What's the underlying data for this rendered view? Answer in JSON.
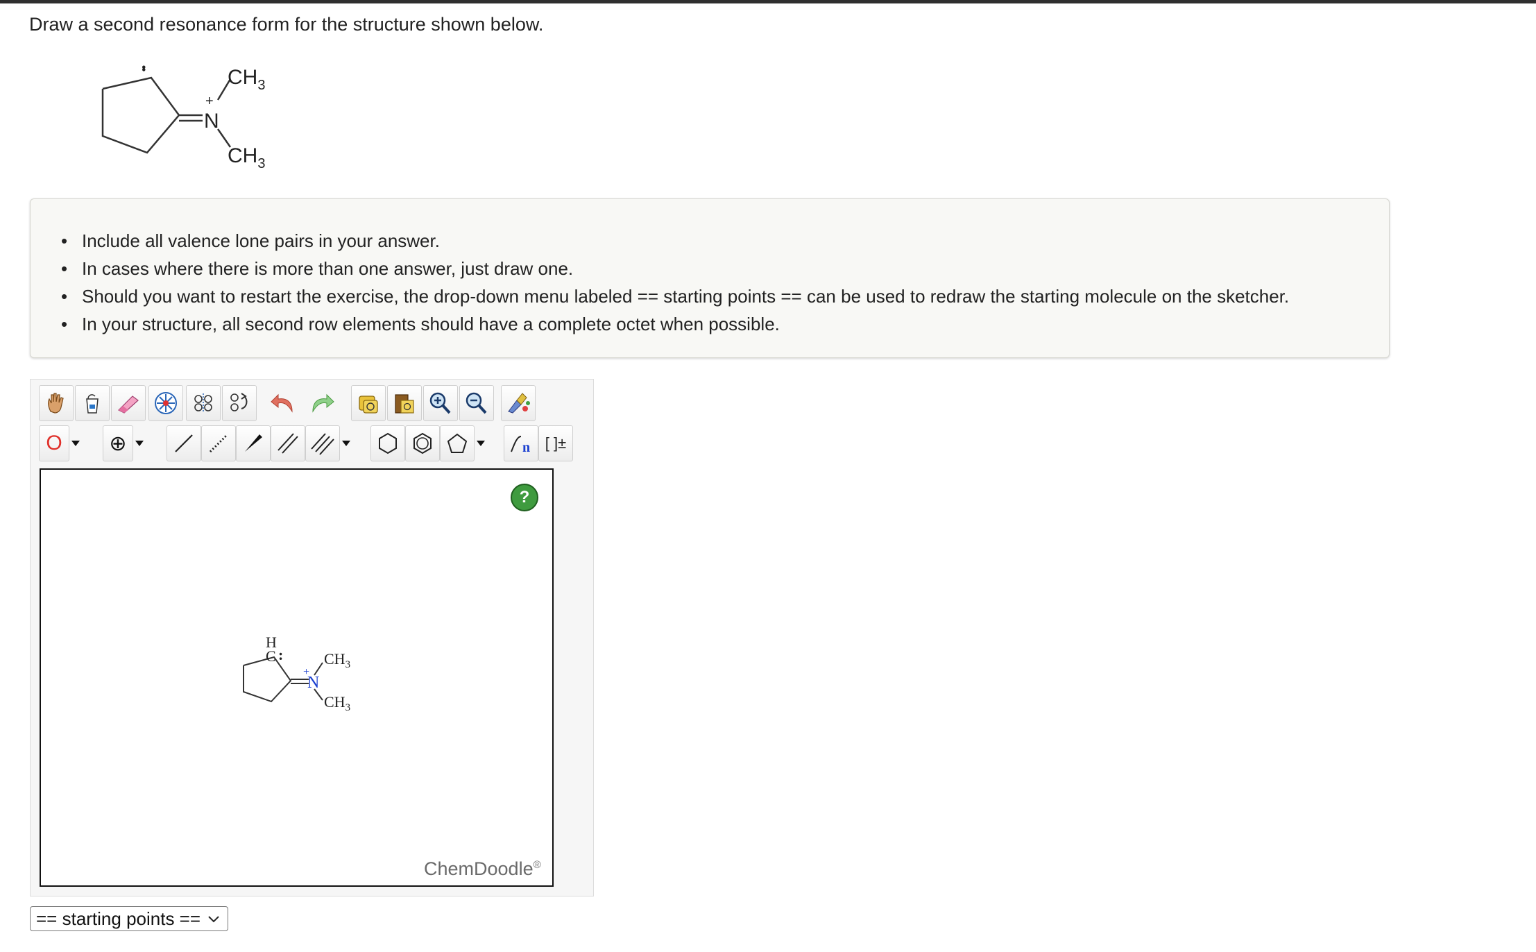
{
  "question": "Draw a second resonance form for the structure shown below.",
  "molecule": {
    "ch3_top": "CH",
    "ch3_bottom": "CH",
    "subscript": "3",
    "nitrogen": "N",
    "charge_plus": "+",
    "lone_pair": "••",
    "canvas_h": "H",
    "canvas_c": "C",
    "canvas_colon": ":",
    "canvas_n": "N"
  },
  "instructions": [
    "Include all valence lone pairs in your answer.",
    "In cases where there is more than one answer, just draw one.",
    "Should you want to restart the exercise, the drop-down menu labeled == starting points == can be used to redraw the starting molecule on the sketcher.",
    "In your structure, all second row elements should have a complete octet when possible."
  ],
  "toolbar": {
    "row1": [
      "hand-icon",
      "clear-icon",
      "eraser-icon",
      "center-icon",
      "flip-icon",
      "rotate-icon",
      "undo-icon",
      "redo-icon",
      "copy-icon",
      "paste-icon",
      "zoom-in-icon",
      "zoom-out-icon",
      "clean-icon"
    ],
    "atom_label": "O",
    "charge_label": "⊕",
    "bracket_label": "[ ]±",
    "chain_label": "n"
  },
  "sketcher": {
    "help_label": "?",
    "watermark": "ChemDoodle",
    "registered": "®"
  },
  "starting_points": {
    "selected": "== starting points =="
  },
  "colors": {
    "help_green": "#3f9b3f",
    "atom_red": "#e0302a",
    "nitrogen_blue": "#1a3fd0"
  }
}
